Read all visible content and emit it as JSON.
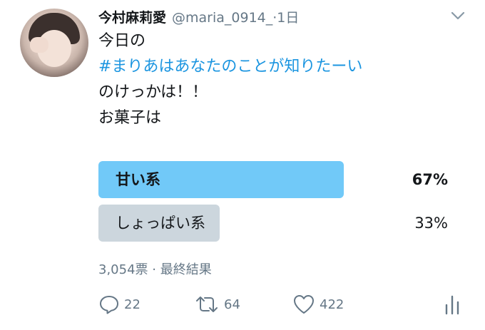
{
  "tweet": {
    "author_name": "今村麻莉愛",
    "handle": "@maria_0914_",
    "time": "·1日",
    "text_lines": [
      {
        "text": "今日の",
        "type": "plain"
      },
      {
        "text": "#まりあはあなたのことが知りたーい",
        "type": "hashtag"
      },
      {
        "text": "のけっかは！！",
        "type": "plain"
      },
      {
        "text": "お菓子は",
        "type": "plain"
      }
    ]
  },
  "poll": {
    "options": [
      {
        "label": "甘い系",
        "percent_text": "67%",
        "percent": 67,
        "winner": true
      },
      {
        "label": "しょっぱい系",
        "percent_text": "33%",
        "percent": 33,
        "winner": false
      }
    ],
    "meta": "3,054票 · 最終結果"
  },
  "actions": {
    "reply_count": "22",
    "retweet_count": "64",
    "like_count": "422"
  },
  "colors": {
    "hashtag": "#1b95e0",
    "poll_winner": "#71c9f8",
    "poll_other": "#ccd6dd",
    "secondary_text": "#657786"
  },
  "icons": [
    "avatar-image",
    "chevron-down-icon",
    "reply-icon",
    "retweet-icon",
    "like-icon",
    "analytics-icon"
  ]
}
